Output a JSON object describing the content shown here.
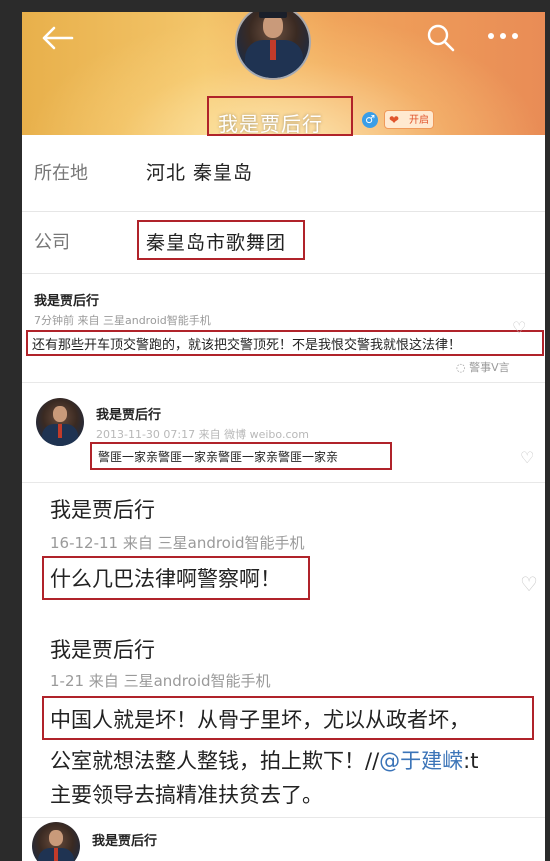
{
  "header": {
    "username": "我是贾后行",
    "gender_icon": "male-icon",
    "badge_label": "开启"
  },
  "profile": {
    "location_label": "所在地",
    "location_value": "河北 秦皇岛",
    "company_label": "公司",
    "company_value": "秦皇岛市歌舞团"
  },
  "posts": [
    {
      "author": "我是贾后行",
      "meta": "7分钟前 来自 三星android智能手机",
      "text": "还有那些开车顶交警跑的，就该把交警顶死！不是我恨交警我就恨这法律！",
      "source_tag": "警事V言"
    },
    {
      "author": "我是贾后行",
      "meta": "2013-11-30 07:17 来自 微博 weibo.com",
      "text": "警匪一家亲警匪一家亲警匪一家亲警匪一家亲"
    },
    {
      "author": "我是贾后行",
      "meta": "16-12-11  来自 三星android智能手机",
      "text": "什么几巴法律啊警察啊！"
    },
    {
      "author": "我是贾后行",
      "meta": "1-21  来自 三星android智能手机",
      "text_line1": "中国人就是坏！从骨子里坏，尤以从政者坏，",
      "text_line2_prefix": "公室就想法整人整钱，拍上欺下！//",
      "text_line2_mention": "@于建嵘",
      "text_line2_suffix": ":t",
      "text_line3": "主要领导去搞精准扶贫去了。"
    },
    {
      "author": "我是贾后行"
    }
  ],
  "colors": {
    "highlight_box": "#b0232a",
    "mention": "#3b74b8"
  }
}
